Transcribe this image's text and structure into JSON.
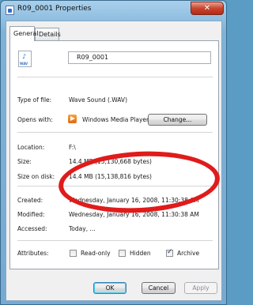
{
  "window": {
    "title": "R09_0001 Properties",
    "close_glyph": "✕"
  },
  "tabs": [
    {
      "label": "General",
      "active": true
    },
    {
      "label": "Details",
      "active": false
    }
  ],
  "file": {
    "name": "R09_0001",
    "icon": "wav-file-icon",
    "icon_ext": "WAV",
    "icon_note": "♪"
  },
  "properties": {
    "type_label": "Type of file:",
    "type_value": "Wave Sound (.WAV)",
    "opens_label": "Opens with:",
    "opens_value": "Windows Media Player",
    "change_button": "Change...",
    "location_label": "Location:",
    "location_value": "F:\\",
    "size_label": "Size:",
    "size_value": "14.4 MB (15,130,668 bytes)",
    "size_disk_label": "Size on disk:",
    "size_disk_value": "14.4 MB (15,138,816 bytes)",
    "created_label": "Created:",
    "created_value": "Wednesday, January 16, 2008, 11:30:38 AM",
    "modified_label": "Modified:",
    "modified_value": "Wednesday, January 16, 2008, 11:30:38 AM",
    "accessed_label": "Accessed:",
    "accessed_value": "Today, ...",
    "attributes_label": "Attributes:"
  },
  "attributes": {
    "readonly": {
      "label": "Read-only",
      "checked": false
    },
    "hidden": {
      "label": "Hidden",
      "checked": false
    },
    "archive": {
      "label": "Archive",
      "checked": true
    }
  },
  "buttons": {
    "ok": "OK",
    "cancel": "Cancel",
    "apply": "Apply"
  },
  "colors": {
    "annotation": "#e01b1b",
    "close": "#c9452f"
  }
}
